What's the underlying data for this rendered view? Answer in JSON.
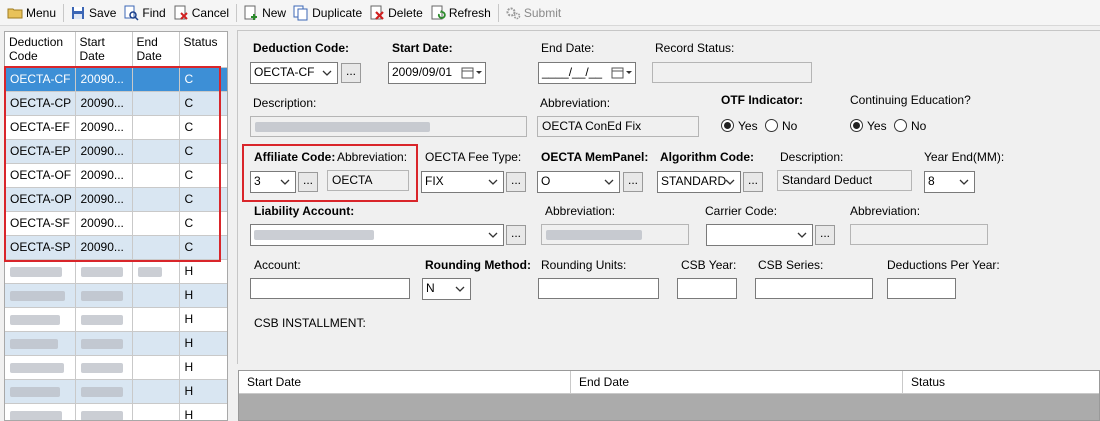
{
  "toolbar": {
    "menu": "Menu",
    "save": "Save",
    "find": "Find",
    "cancel": "Cancel",
    "new": "New",
    "duplicate": "Duplicate",
    "delete": "Delete",
    "refresh": "Refresh",
    "submit": "Submit"
  },
  "grid": {
    "headers": {
      "deduction_code_1": "Deduction",
      "deduction_code_2": "Code",
      "start_date_1": "Start",
      "start_date_2": "Date",
      "end_date_1": "End",
      "end_date_2": "Date",
      "status": "Status"
    },
    "rows": [
      {
        "code": "OECTA-CF",
        "start": "20090...",
        "end": "",
        "status": "C"
      },
      {
        "code": "OECTA-CP",
        "start": "20090...",
        "end": "",
        "status": "C"
      },
      {
        "code": "OECTA-EF",
        "start": "20090...",
        "end": "",
        "status": "C"
      },
      {
        "code": "OECTA-EP",
        "start": "20090...",
        "end": "",
        "status": "C"
      },
      {
        "code": "OECTA-OF",
        "start": "20090...",
        "end": "",
        "status": "C"
      },
      {
        "code": "OECTA-OP",
        "start": "20090...",
        "end": "",
        "status": "C"
      },
      {
        "code": "OECTA-SF",
        "start": "20090...",
        "end": "",
        "status": "C"
      },
      {
        "code": "OECTA-SP",
        "start": "20090...",
        "end": "",
        "status": "C"
      }
    ],
    "redacted_rows_status": [
      "H",
      "H",
      "H",
      "H",
      "H",
      "H",
      "H"
    ]
  },
  "form": {
    "deduction_code_label": "Deduction Code:",
    "deduction_code_value": "OECTA-CF",
    "start_date_label": "Start Date:",
    "start_date_value": "2009/09/01",
    "end_date_label": "End Date:",
    "end_date_value": "____/__/__",
    "record_status_label": "Record Status:",
    "record_status_value": "",
    "description_label": "Description:",
    "abbreviation_label": "Abbreviation:",
    "abbreviation_value": "OECTA ConEd Fix",
    "otf_label": "OTF Indicator:",
    "otf_yes": "Yes",
    "otf_no": "No",
    "otf_selected": "Yes",
    "cont_ed_label": "Continuing Education?",
    "cont_ed_yes": "Yes",
    "cont_ed_no": "No",
    "cont_ed_selected": "Yes",
    "affiliate_code_label": "Affiliate Code:",
    "affiliate_abbrev_label": "Abbreviation:",
    "affiliate_code_value": "3",
    "affiliate_abbrev_value": "OECTA",
    "fee_type_label": "OECTA Fee Type:",
    "fee_type_value": "FIX",
    "mempanel_label": "OECTA MemPanel:",
    "mempanel_value": "O",
    "algorithm_label": "Algorithm Code:",
    "algorithm_value": "STANDARD",
    "algorithm_desc_label": "Description:",
    "algorithm_desc_value": "Standard Deduct",
    "year_end_label": "Year End(MM):",
    "year_end_value": "8",
    "liability_label": "Liability Account:",
    "liability_abbrev_label": "Abbreviation:",
    "carrier_label": "Carrier Code:",
    "carrier_abbrev_label": "Abbreviation:",
    "account_label": "Account:",
    "rounding_method_label": "Rounding Method:",
    "rounding_method_value": "N",
    "rounding_units_label": "Rounding Units:",
    "csb_year_label": "CSB Year:",
    "csb_series_label": "CSB Series:",
    "deductions_per_year_label": "Deductions Per Year:",
    "csb_installment_label": "CSB INSTALLMENT:",
    "ellipsis": "..."
  },
  "bottom": {
    "start_date": "Start Date",
    "end_date": "End Date",
    "status": "Status"
  },
  "colors": {
    "selected_row": "#3d8fd6",
    "alt_row": "#d9e6f2",
    "highlight_box": "#d9252a"
  }
}
